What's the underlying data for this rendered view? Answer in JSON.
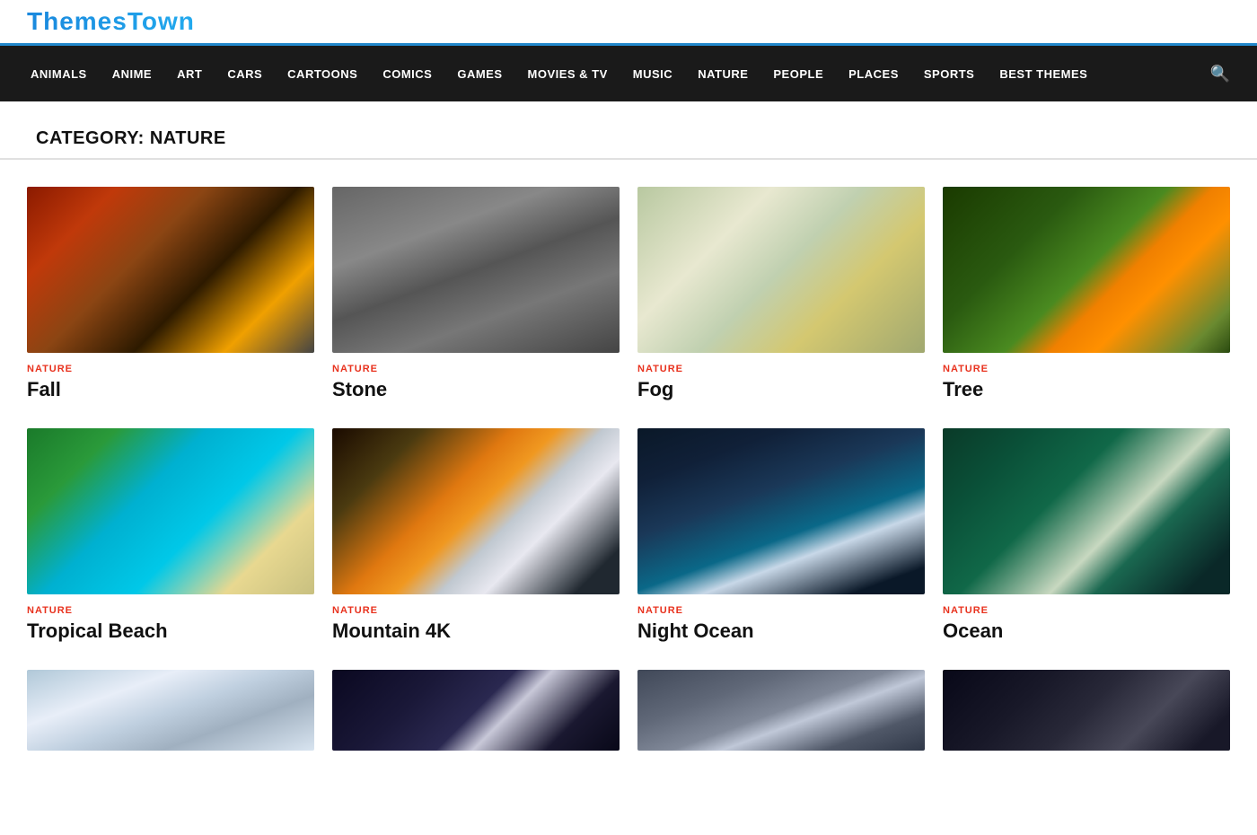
{
  "logo": {
    "text": "ThemesTown"
  },
  "nav": {
    "items": [
      {
        "label": "ANIMALS",
        "id": "animals"
      },
      {
        "label": "ANIME",
        "id": "anime"
      },
      {
        "label": "ART",
        "id": "art"
      },
      {
        "label": "CARS",
        "id": "cars"
      },
      {
        "label": "CARTOONS",
        "id": "cartoons"
      },
      {
        "label": "COMICS",
        "id": "comics"
      },
      {
        "label": "GAMES",
        "id": "games"
      },
      {
        "label": "MOVIES & TV",
        "id": "movies-tv"
      },
      {
        "label": "MUSIC",
        "id": "music"
      },
      {
        "label": "NATURE",
        "id": "nature"
      },
      {
        "label": "PEOPLE",
        "id": "people"
      },
      {
        "label": "PLACES",
        "id": "places"
      },
      {
        "label": "SPORTS",
        "id": "sports"
      },
      {
        "label": "BEST THEMES",
        "id": "best-themes"
      }
    ]
  },
  "category": {
    "heading": "CATEGORY: NATURE"
  },
  "cards": [
    {
      "id": "fall",
      "category": "NATURE",
      "title": "Fall",
      "imgClass": "img-fall"
    },
    {
      "id": "stone",
      "category": "NATURE",
      "title": "Stone",
      "imgClass": "img-stone"
    },
    {
      "id": "fog",
      "category": "NATURE",
      "title": "Fog",
      "imgClass": "img-fog"
    },
    {
      "id": "tree",
      "category": "NATURE",
      "title": "Tree",
      "imgClass": "img-tree"
    },
    {
      "id": "tropical-beach",
      "category": "NATURE",
      "title": "Tropical Beach",
      "imgClass": "img-tropical"
    },
    {
      "id": "mountain-4k",
      "category": "NATURE",
      "title": "Mountain 4K",
      "imgClass": "img-mountain"
    },
    {
      "id": "night-ocean",
      "category": "NATURE",
      "title": "Night Ocean",
      "imgClass": "img-night-ocean"
    },
    {
      "id": "ocean",
      "category": "NATURE",
      "title": "Ocean",
      "imgClass": "img-ocean"
    }
  ],
  "partial_cards": [
    {
      "id": "snow-trees",
      "imgClass": "img-snow-trees"
    },
    {
      "id": "moon",
      "imgClass": "img-moon"
    },
    {
      "id": "drops",
      "imgClass": "img-drops"
    },
    {
      "id": "space",
      "imgClass": "img-space"
    }
  ]
}
